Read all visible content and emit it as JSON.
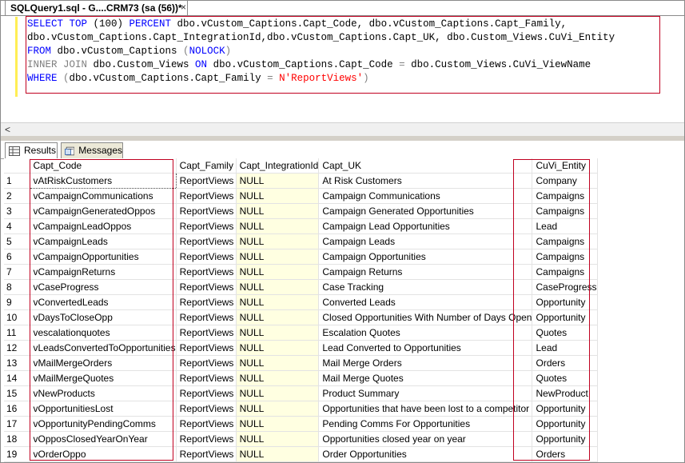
{
  "document_tab": {
    "title": "SQLQuery1.sql - G....CRM73 (sa (56))*",
    "close_glyph": "×"
  },
  "query": {
    "line1": {
      "k1": "SELECT TOP",
      "a": " (100) ",
      "k2": "PERCENT",
      "b": " dbo.vCustom_Captions.Capt_Code, dbo.vCustom_Captions.Capt_Family,"
    },
    "line2": {
      "a": "dbo.vCustom_Captions.Capt_IntegrationId,dbo.vCustom_Captions.Capt_UK, dbo.Custom_Views.CuVi_Entity"
    },
    "line3": {
      "k1": "FROM",
      "a": " dbo.vCustom_Captions ",
      "g": "(",
      "k2": "NOLOCK",
      "g2": ")"
    },
    "line4": {
      "g": "INNER JOIN",
      "a": " dbo.Custom_Views ",
      "k1": "ON",
      "b": " dbo.vCustom_Captions.Capt_Code ",
      "g2": "=",
      "c": " dbo.Custom_Views.CuVi_ViewName"
    },
    "line5": {
      "k1": "WHERE",
      "g": " (",
      "a": "dbo.vCustom_Captions.Capt_Family ",
      "g2": "=",
      "s": " N'ReportViews'",
      "g3": ")"
    }
  },
  "result_tabs": {
    "results": "Results",
    "messages": "Messages"
  },
  "columns": [
    "Capt_Code",
    "Capt_Family",
    "Capt_IntegrationId",
    "Capt_UK",
    "CuVi_Entity"
  ],
  "rows": [
    [
      "1",
      "vAtRiskCustomers",
      "ReportViews",
      "NULL",
      "At Risk Customers",
      "Company"
    ],
    [
      "2",
      "vCampaignCommunications",
      "ReportViews",
      "NULL",
      "Campaign Communications",
      "Campaigns"
    ],
    [
      "3",
      "vCampaignGeneratedOppos",
      "ReportViews",
      "NULL",
      "Campaign Generated Opportunities",
      "Campaigns"
    ],
    [
      "4",
      "vCampaignLeadOppos",
      "ReportViews",
      "NULL",
      "Campaign Lead Opportunities",
      "Lead"
    ],
    [
      "5",
      "vCampaignLeads",
      "ReportViews",
      "NULL",
      "Campaign Leads",
      "Campaigns"
    ],
    [
      "6",
      "vCampaignOpportunities",
      "ReportViews",
      "NULL",
      "Campaign Opportunities",
      "Campaigns"
    ],
    [
      "7",
      "vCampaignReturns",
      "ReportViews",
      "NULL",
      "Campaign Returns",
      "Campaigns"
    ],
    [
      "8",
      "vCaseProgress",
      "ReportViews",
      "NULL",
      "Case Tracking",
      "CaseProgress"
    ],
    [
      "9",
      "vConvertedLeads",
      "ReportViews",
      "NULL",
      "Converted Leads",
      "Opportunity"
    ],
    [
      "10",
      "vDaysToCloseOpp",
      "ReportViews",
      "NULL",
      "Closed Opportunities With Number of Days Open",
      "Opportunity"
    ],
    [
      "11",
      "vescalationquotes",
      "ReportViews",
      "NULL",
      "Escalation Quotes",
      "Quotes"
    ],
    [
      "12",
      "vLeadsConvertedToOpportunities",
      "ReportViews",
      "NULL",
      "Lead Converted to Opportunities",
      "Lead"
    ],
    [
      "13",
      "vMailMergeOrders",
      "ReportViews",
      "NULL",
      "Mail Merge Orders",
      "Orders"
    ],
    [
      "14",
      "vMailMergeQuotes",
      "ReportViews",
      "NULL",
      "Mail Merge Quotes",
      "Quotes"
    ],
    [
      "15",
      "vNewProducts",
      "ReportViews",
      "NULL",
      "Product Summary",
      "NewProduct"
    ],
    [
      "16",
      "vOpportunitiesLost",
      "ReportViews",
      "NULL",
      "Opportunities that have been lost to a competitor",
      "Opportunity"
    ],
    [
      "17",
      "vOpportunityPendingComms",
      "ReportViews",
      "NULL",
      "Pending Comms For Opportunities",
      "Opportunity"
    ],
    [
      "18",
      "vOpposClosedYearOnYear",
      "ReportViews",
      "NULL",
      "Opportunities closed year on year",
      "Opportunity"
    ],
    [
      "19",
      "vOrderOppo",
      "ReportViews",
      "NULL",
      "Order Opportunities",
      "Orders"
    ]
  ],
  "colors": {
    "keyword": "#0000ff",
    "comment_gray": "#808080",
    "string": "#ff0000",
    "highlight_box": "#c00020",
    "null_cell": "#ffffe1"
  }
}
